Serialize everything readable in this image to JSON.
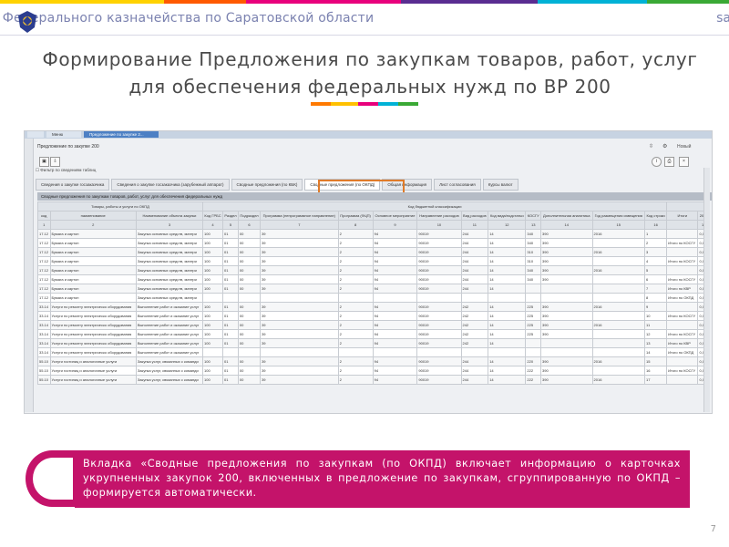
{
  "header": {
    "title": "ие Федерального казначейства по Саратовской области",
    "site": "sa",
    "colors": {
      "text": "#7b82b0",
      "stripe": [
        "#ffd200",
        "#ff5a00",
        "#e8007c",
        "#5a2d91",
        "#00b2d6",
        "#3aa935"
      ]
    }
  },
  "slide": {
    "title": "Формирование Предложения по закупкам товаров, работ, услуг для обеспечения федеральных нужд по ВР 200",
    "callout": "Вкладка «Сводные предложения по закупкам (по ОКПД) включает информацию о карточках укрупненных закупок 200, включенных в предложение по закупкам, сгруппированную по ОКПД – формируется автоматически.",
    "page_number": "7",
    "accent_color": "#c4136a"
  },
  "app": {
    "top_tabs": [
      "",
      "Меню",
      "Предложение по закупке 2..."
    ],
    "panel_title": "Предложение по закупке 200",
    "filter_label": "Фильтр по сведениям таблиц",
    "tabs": [
      "Сведения о закупке госзаказчика",
      "Сведения о закупке госзаказчика (зарубежный аппарат)",
      "Сводные предложения (по КБК)",
      "Сводные предложения (по ОКПД)",
      "Общая информация",
      "Лист согласования",
      "Курсы валют"
    ],
    "active_tab_index": 3,
    "section_header": "Сводные предложения по закупкам товаров, работ, услуг для обеспечения федеральных нужд",
    "new_button": "Новый",
    "table": {
      "group_headers": [
        "Товары, работы и услуги по ОКПД",
        "Код бюджетной классификации",
        "целевая статья расходов"
      ],
      "columns": [
        "код",
        "наименование",
        "Наименование объекта закупки",
        "Код ГРБС",
        "Раздел",
        "Подраздел",
        "Программа (непрограммное направление)",
        "Программа (ФЦП)",
        "Основное мероприятие",
        "Направление расходов",
        "Вид расходов",
        "Код вида/подстатьи",
        "КОСГУ",
        "Дополнительная аналитика",
        "Год размещения извещения",
        "Код строки",
        "Итоги",
        "2016"
      ],
      "col_numbers": [
        "1",
        "2",
        "3",
        "4",
        "5",
        "6",
        "7",
        "8",
        "9",
        "10",
        "11",
        "12",
        "13",
        "14",
        "15",
        "16",
        "",
        "17"
      ],
      "rows": [
        [
          "17.12",
          "Бумага и картон",
          "Закупка основных средств, матери",
          "100",
          "01",
          "00",
          "39",
          "2",
          "94",
          "90019",
          "244",
          "14",
          "340",
          "390",
          "2016",
          "1",
          "",
          "0,0"
        ],
        [
          "17.12",
          "Бумага и картон",
          "Закупка основных средств, матери",
          "100",
          "01",
          "00",
          "39",
          "2",
          "94",
          "90019",
          "244",
          "14",
          "340",
          "390",
          "",
          "2",
          "Итого по КОСГУ",
          "0,0"
        ],
        [
          "17.12",
          "Бумага и картон",
          "Закупка основных средств, матери",
          "100",
          "01",
          "00",
          "39",
          "2",
          "94",
          "90019",
          "244",
          "14",
          "310",
          "390",
          "2016",
          "3",
          "",
          "0,0"
        ],
        [
          "17.12",
          "Бумага и картон",
          "Закупка основных средств, матери",
          "100",
          "01",
          "00",
          "39",
          "2",
          "94",
          "90019",
          "244",
          "14",
          "310",
          "390",
          "",
          "4",
          "Итого по КОСГУ",
          "0,0"
        ],
        [
          "17.12",
          "Бумага и картон",
          "Закупка основных средств, матери",
          "100",
          "01",
          "00",
          "39",
          "2",
          "94",
          "90019",
          "244",
          "14",
          "340",
          "390",
          "2016",
          "5",
          "",
          "0,0"
        ],
        [
          "17.12",
          "Бумага и картон",
          "Закупка основных средств, матери",
          "100",
          "01",
          "00",
          "39",
          "2",
          "94",
          "90019",
          "244",
          "14",
          "340",
          "390",
          "",
          "6",
          "Итого по КОСГУ",
          "0,0"
        ],
        [
          "17.12",
          "Бумага и картон",
          "Закупка основных средств, матери",
          "100",
          "01",
          "00",
          "39",
          "2",
          "94",
          "90019",
          "244",
          "14",
          "",
          "",
          "",
          "7",
          "Итого по КВР",
          "0,0"
        ],
        [
          "17.12",
          "Бумага и картон",
          "Закупка основных средств, матери",
          "",
          "",
          "",
          "",
          "",
          "",
          "",
          "",
          "",
          "",
          "",
          "",
          "8",
          "Итого по ОКПД",
          "0,0"
        ],
        [
          "33.14",
          "Услуги по ремонту электрическо оборудования",
          "Выполнение работ и оказание услуг",
          "100",
          "01",
          "00",
          "39",
          "2",
          "94",
          "90019",
          "242",
          "14",
          "225",
          "390",
          "2016",
          "9",
          "",
          "0,0"
        ],
        [
          "33.14",
          "Услуги по ремонту электрическо оборудования",
          "Выполнение работ и оказание услуг",
          "100",
          "01",
          "00",
          "39",
          "2",
          "94",
          "90019",
          "242",
          "14",
          "225",
          "390",
          "",
          "10",
          "Итого по КОСГУ",
          "0,0"
        ],
        [
          "33.14",
          "Услуги по ремонту электрическо оборудования",
          "Выполнение работ и оказание услуг",
          "100",
          "01",
          "00",
          "39",
          "2",
          "94",
          "90019",
          "242",
          "14",
          "225",
          "390",
          "2016",
          "11",
          "",
          "0,0"
        ],
        [
          "33.14",
          "Услуги по ремонту электрическо оборудования",
          "Выполнение работ и оказание услуг",
          "100",
          "01",
          "00",
          "39",
          "2",
          "94",
          "90019",
          "242",
          "14",
          "225",
          "390",
          "",
          "12",
          "Итого по КОСГУ",
          "0,0"
        ],
        [
          "33.14",
          "Услуги по ремонту электрическо оборудования",
          "Выполнение работ и оказание услуг",
          "100",
          "01",
          "00",
          "39",
          "2",
          "94",
          "90019",
          "242",
          "14",
          "",
          "",
          "",
          "13",
          "Итого по КВР",
          "0,0"
        ],
        [
          "33.14",
          "Услуги по ремонту электрическо оборудования",
          "Выполнение работ и оказание услуг",
          "",
          "",
          "",
          "",
          "",
          "",
          "",
          "",
          "",
          "",
          "",
          "",
          "14",
          "Итого по ОКПД",
          "0,0"
        ],
        [
          "55.10",
          "Услуги гостиниц и аналогичные услуги",
          "Закупка услуг, связанных с команди",
          "100",
          "01",
          "00",
          "39",
          "2",
          "94",
          "90019",
          "244",
          "14",
          "220",
          "390",
          "2016",
          "15",
          "",
          "0,0"
        ],
        [
          "55.10",
          "Услуги гостиниц и аналогичные услуги",
          "Закупка услуг, связанных с команди",
          "100",
          "01",
          "00",
          "39",
          "2",
          "94",
          "90019",
          "244",
          "14",
          "222",
          "390",
          "",
          "16",
          "Итого по КОСГУ",
          "0,0"
        ],
        [
          "55.10",
          "Услуги гостиниц и аналогичные услуги",
          "Закупка услуг, связанных с команди",
          "100",
          "01",
          "00",
          "39",
          "2",
          "94",
          "90019",
          "244",
          "14",
          "222",
          "390",
          "2016",
          "17",
          "",
          "0,0"
        ]
      ]
    }
  }
}
